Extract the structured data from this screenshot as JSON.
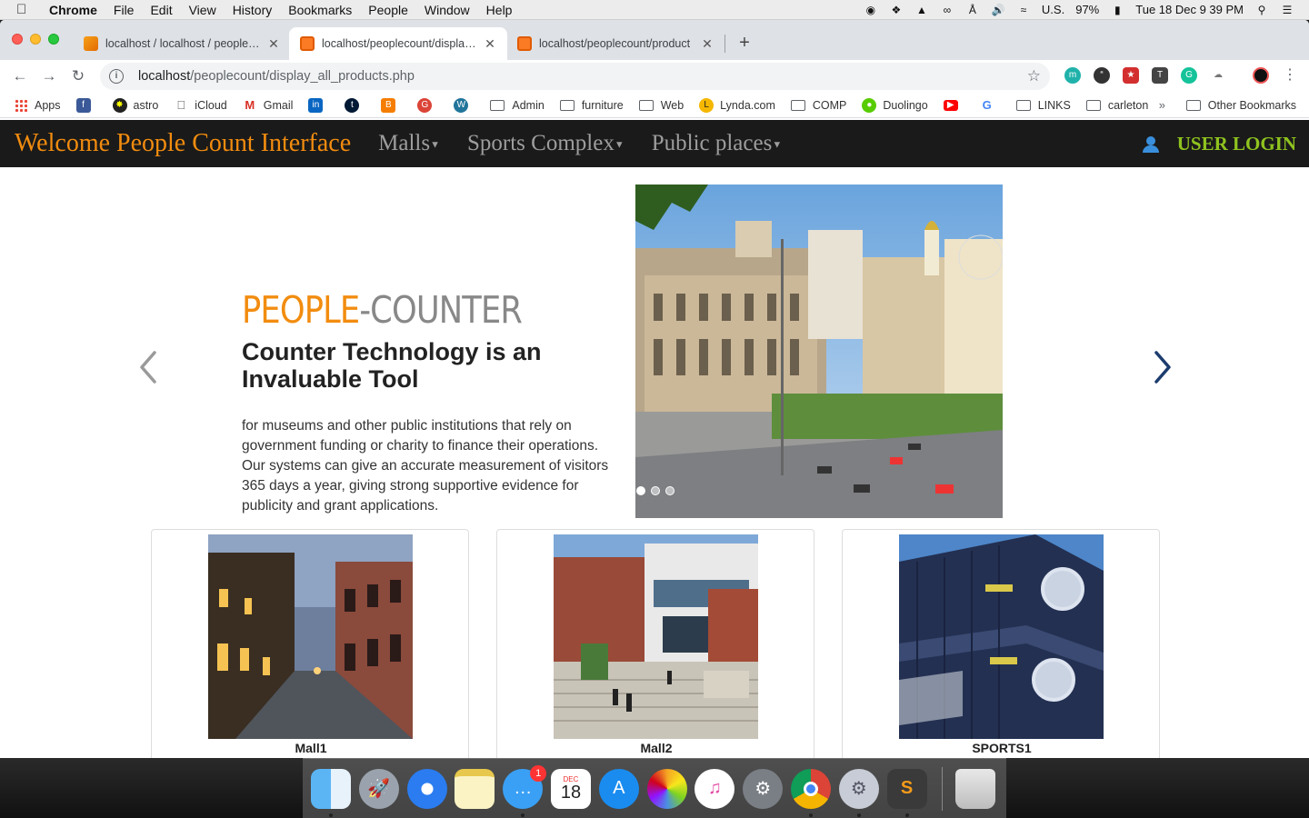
{
  "menubar": {
    "app_name": "Chrome",
    "items": [
      "File",
      "Edit",
      "View",
      "History",
      "Bookmarks",
      "People",
      "Window",
      "Help"
    ],
    "locale": "U.S.",
    "battery": "97%",
    "clock": "Tue 18 Dec  9 39 PM"
  },
  "tabs": [
    {
      "title": "localhost / localhost / people_c",
      "favicon": "phpmyadmin-icon"
    },
    {
      "title": "localhost/peoplecount/display_",
      "favicon": "xampp-icon"
    },
    {
      "title": "localhost/peoplecount/product",
      "favicon": "xampp-icon"
    }
  ],
  "address_bar": {
    "host": "localhost",
    "path": "/peoplecount/display_all_products.php"
  },
  "bookmarks": [
    {
      "label": "Apps",
      "icon": "apps-grid-icon"
    },
    {
      "label": "",
      "icon": "facebook-icon",
      "color": "#3b5998"
    },
    {
      "label": "astro",
      "icon": "astro-icon",
      "color": "#222"
    },
    {
      "label": "iCloud",
      "icon": "apple-icon",
      "color": "#555"
    },
    {
      "label": "Gmail",
      "icon": "gmail-icon",
      "color": "#d93025"
    },
    {
      "label": "",
      "icon": "linkedin-icon",
      "color": "#0a66c2"
    },
    {
      "label": "",
      "icon": "tumblr-icon",
      "color": "#001935"
    },
    {
      "label": "",
      "icon": "blogger-icon",
      "color": "#f57d00"
    },
    {
      "label": "",
      "icon": "google-plus-icon",
      "color": "#db4437"
    },
    {
      "label": "",
      "icon": "wordpress-icon",
      "color": "#21759b"
    },
    {
      "label": "Admin",
      "icon": "folder-icon"
    },
    {
      "label": "furniture",
      "icon": "folder-icon"
    },
    {
      "label": "Web",
      "icon": "folder-icon"
    },
    {
      "label": "Lynda.com",
      "icon": "lynda-icon",
      "color": "#f5b700"
    },
    {
      "label": "COMP",
      "icon": "folder-icon"
    },
    {
      "label": "Duolingo",
      "icon": "duolingo-icon",
      "color": "#58cc02"
    },
    {
      "label": "",
      "icon": "youtube-icon",
      "color": "#ff0000"
    },
    {
      "label": "",
      "icon": "google-icon",
      "color": "#4285f4"
    },
    {
      "label": "LINKS",
      "icon": "folder-icon"
    },
    {
      "label": "carleton",
      "icon": "folder-icon"
    }
  ],
  "other_bookmarks": "Other Bookmarks",
  "site": {
    "brand": "Welcome People Count Interface",
    "nav": [
      "Malls",
      "Sports Complex",
      "Public places"
    ],
    "user_login": "USER LOGIN",
    "accent": "#f28c0f",
    "login_color": "#8fc31f"
  },
  "slide": {
    "heading_part1": "PEOPLE",
    "heading_part2": "-COUNTER",
    "subheading": "Counter Technology is an Invaluable Tool",
    "body": "for museums and other public institutions that rely on government funding or charity to finance their operations. Our systems can give an accurate measurement of visitors 365 days a year, giving strong supportive evidence for publicity and grant applications."
  },
  "cards": [
    {
      "name": "Mall1"
    },
    {
      "name": "Mall2"
    },
    {
      "name": "SPORTS1"
    }
  ],
  "dock": [
    {
      "app": "finder-icon",
      "running": true
    },
    {
      "app": "launchpad-icon",
      "running": false
    },
    {
      "app": "safari-icon",
      "running": false
    },
    {
      "app": "notes-icon",
      "running": false
    },
    {
      "app": "messages-icon",
      "running": true,
      "badge": "1"
    },
    {
      "app": "calendar-icon",
      "running": false,
      "label_month": "DEC",
      "label_day": "18"
    },
    {
      "app": "app-store-icon",
      "running": false
    },
    {
      "app": "photos-icon",
      "running": false
    },
    {
      "app": "itunes-icon",
      "running": false
    },
    {
      "app": "system-preferences-icon",
      "running": false
    },
    {
      "app": "chrome-icon",
      "running": true
    },
    {
      "app": "settings-icon",
      "running": true
    },
    {
      "app": "sublime-text-icon",
      "running": true
    },
    {
      "app": "trash-icon",
      "running": false
    }
  ]
}
